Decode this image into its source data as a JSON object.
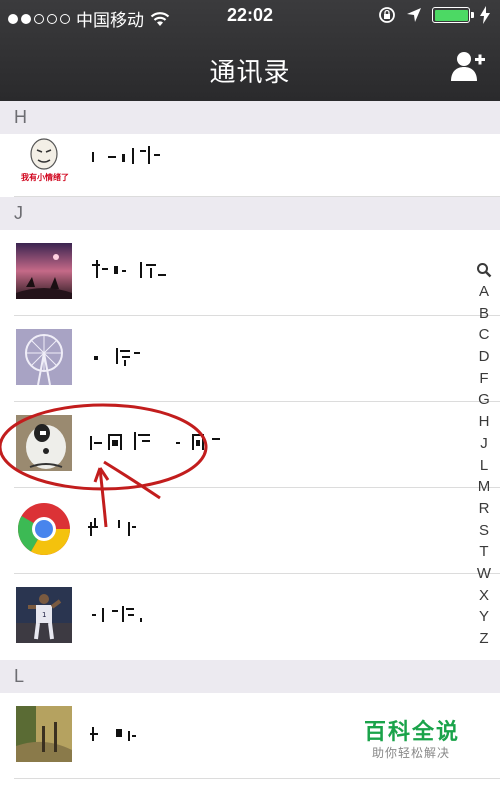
{
  "status_bar": {
    "carrier": "中国移动",
    "time": "22:02"
  },
  "nav": {
    "title": "通讯录",
    "add_icon": "add-contact-icon"
  },
  "sections": [
    {
      "letter": "H"
    },
    {
      "letter": "J"
    },
    {
      "letter": "L"
    }
  ],
  "contacts": [
    {
      "avatar": "meme-face",
      "avatar_caption": "我有小情绪了"
    },
    {
      "avatar": "purple-sky-couple"
    },
    {
      "avatar": "ferris-wheel"
    },
    {
      "avatar": "white-dog"
    },
    {
      "avatar": "chrome-logo"
    },
    {
      "avatar": "basketball-player"
    },
    {
      "avatar": "forest-path"
    }
  ],
  "index_bar": [
    "A",
    "B",
    "C",
    "D",
    "F",
    "G",
    "H",
    "J",
    "L",
    "M",
    "R",
    "S",
    "T",
    "W",
    "X",
    "Y",
    "Z"
  ],
  "watermark": {
    "title": "百科全说",
    "subtitle": "助你轻松解决"
  },
  "colors": {
    "battery": "#4cd964",
    "annotation": "#c21d1d",
    "section_bg": "#eceaf0",
    "watermark_green": "#1aa34a"
  }
}
